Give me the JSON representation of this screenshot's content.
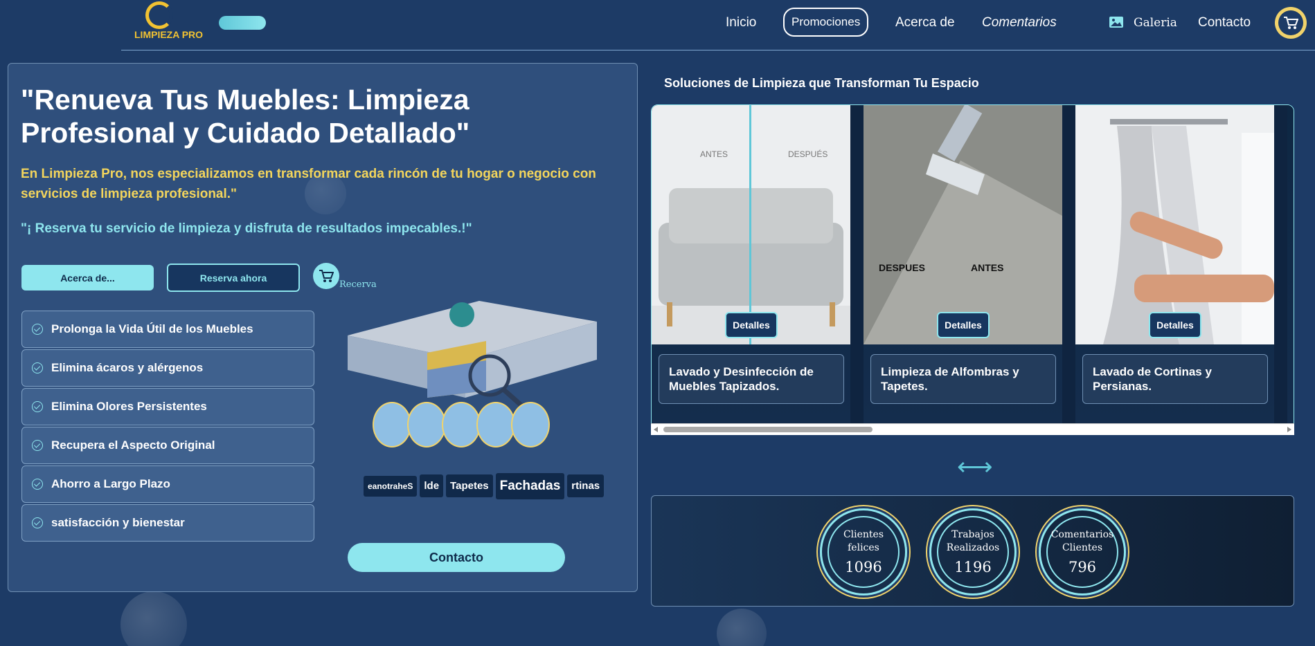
{
  "nav": {
    "logo_text": "LIMPIEZA PRO",
    "items": [
      "Inicio",
      "Promociones",
      "Acerca de",
      "Comentarios",
      "Galeria",
      "Contacto"
    ]
  },
  "hero": {
    "title": "\"Renueva Tus Muebles: Limpieza Profesional y Cuidado Detallado\"",
    "intro": "En Limpieza Pro, nos especializamos en transformar cada rincón de tu hogar o negocio con servicios de limpieza profesional.\"",
    "cta": "\"¡ Reserva tu servicio de limpieza y disfruta de resultados impecables.!\"",
    "btn_about": "Acerca de...",
    "btn_reserve": "Reserva ahora",
    "reserve_label": "Recerva",
    "contact_btn": "Contacto"
  },
  "features": [
    "Prolonga la Vida Útil de los Muebles",
    "Elimina ácaros y alérgenos",
    "Elimina Olores Persistentes",
    "Recupera el Aspecto Original",
    "Ahorro a Largo Plazo",
    "satisfacción y bienestar"
  ],
  "words": [
    "eanotraheS",
    "lde",
    "Tapetes",
    "Fachadas",
    "rtinas"
  ],
  "solutions": {
    "title": "Soluciones de Limpieza que Transforman Tu Espacio",
    "details_label": "Detalles",
    "slides": [
      {
        "caption": "Lavado y Desinfección de Muebles Tapizados.",
        "label_a": "ANTES",
        "label_b": "DESPUÉS"
      },
      {
        "caption": "Limpieza de Alfombras y Tapetes.",
        "label_a": "DESPUES",
        "label_b": "ANTES"
      },
      {
        "caption": "Lavado de Cortinas y Persianas."
      }
    ]
  },
  "swap_icon": "⟷",
  "stats": [
    {
      "label1": "Clientes",
      "label2": "felices",
      "value": "1096"
    },
    {
      "label1": "Trabajos",
      "label2": "Realizados",
      "value": "1196"
    },
    {
      "label1": "Comentarios",
      "label2": "Clientes",
      "value": "796"
    }
  ],
  "colors": {
    "accent": "#8ee6ee",
    "gold": "#f3d55c",
    "bg": "#1d3b66"
  }
}
